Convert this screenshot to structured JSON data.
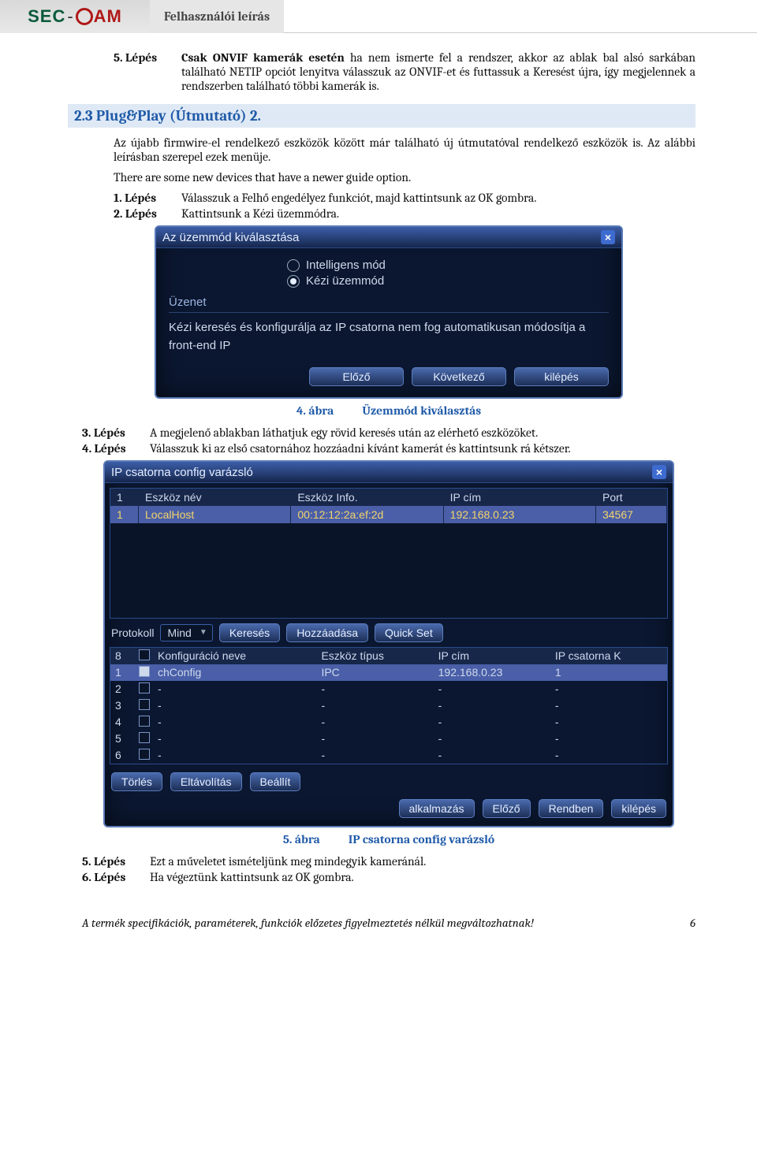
{
  "header": {
    "logo_sec": "SEC",
    "logo_cam": "AM",
    "tab": "Felhasználói leírás"
  },
  "step5": {
    "label": "5. Lépés",
    "text": "Csak ONVIF kamerák esetén ha nem ismerte fel a rendszer, akkor az ablak bal alsó sarkában található NETIP opciót lenyitva válasszuk az ONVIF-et és futtassuk a Keresést újra, így megjelennek a rendszerben található többi kamerák is.",
    "bold": "Csak ONVIF kamerák esetén"
  },
  "section": "2.3   Plug&Play (Útmutató) 2.",
  "para1": "Az újabb firmwire-el rendelkező eszközök között már található új útmutatóval rendelkező eszközök is. Az alábbi leírásban szerepel ezek menüje.",
  "para2": "There are some new devices that have a newer guide option.",
  "step1": {
    "label": "1. Lépés",
    "text": "Válasszuk a Felhő engedélyez funkciót, majd kattintsunk az OK gombra."
  },
  "step2": {
    "label": "2. Lépés",
    "text": "Kattintsunk a Kézi üzemmódra."
  },
  "shot1": {
    "title": "Az üzemmód kiválasztása",
    "opt1": "Intelligens mód",
    "opt2": "Kézi üzemmód",
    "group": "Üzenet",
    "msg": "Kézi keresés és konfigurálja az IP csatorna nem fog automatikusan módosítja a front-end IP",
    "btn_prev": "Előző",
    "btn_next": "Következő",
    "btn_exit": "kilépés"
  },
  "caption4": {
    "no": "4. ábra",
    "text": "Üzemmód kiválasztás"
  },
  "step3": {
    "label": "3. Lépés",
    "text": "A megjelenő ablakban láthatjuk egy rövid keresés után az elérhető eszközöket."
  },
  "step4": {
    "label": "4. Lépés",
    "text": "Válasszuk ki az első csatornához hozzáadni kívánt kamerát és kattintsunk rá kétszer."
  },
  "shot2": {
    "title": "IP csatorna config varázsló",
    "cols": {
      "c0": "1",
      "c1": "Eszköz név",
      "c2": "Eszköz Info.",
      "c3": "IP cím",
      "c4": "Port"
    },
    "row": {
      "c0": "1",
      "c1": "LocalHost",
      "c2": "00:12:12:2a:ef:2d",
      "c3": "192.168.0.23",
      "c4": "34567"
    },
    "proto_label": "Protokoll",
    "proto_value": "Mind",
    "btn_search": "Keresés",
    "btn_add": "Hozzáadása",
    "btn_quick": "Quick Set",
    "cols2": {
      "c0": "8",
      "c2": "Konfiguráció neve",
      "c3": "Eszköz típus",
      "c4": "IP cím",
      "c5": "IP csatorna K"
    },
    "rows2": [
      {
        "n": "1",
        "chk": true,
        "a": "chConfig",
        "b": "IPC",
        "c": "192.168.0.23",
        "d": "1"
      },
      {
        "n": "2",
        "chk": false,
        "a": "-",
        "b": "-",
        "c": "-",
        "d": "-"
      },
      {
        "n": "3",
        "chk": false,
        "a": "-",
        "b": "-",
        "c": "-",
        "d": "-"
      },
      {
        "n": "4",
        "chk": false,
        "a": "-",
        "b": "-",
        "c": "-",
        "d": "-"
      },
      {
        "n": "5",
        "chk": false,
        "a": "-",
        "b": "-",
        "c": "-",
        "d": "-"
      },
      {
        "n": "6",
        "chk": false,
        "a": "-",
        "b": "-",
        "c": "-",
        "d": "-"
      }
    ],
    "btn_del": "Törlés",
    "btn_rem": "Eltávolítás",
    "btn_set": "Beállít",
    "btn_apply": "alkalmazás",
    "btn_prev": "Előző",
    "btn_ok": "Rendben",
    "btn_exit": "kilépés"
  },
  "caption5": {
    "no": "5. ábra",
    "text": "IP csatorna config varázsló"
  },
  "step5b": {
    "label": "5. Lépés",
    "text": "Ezt a műveletet ismételjünk meg mindegyik kameránál."
  },
  "step6": {
    "label": "6. Lépés",
    "text": "Ha végeztünk kattintsunk az OK gombra."
  },
  "footer": {
    "text": "A termék specifikációk, paraméterek, funkciók előzetes figyelmeztetés nélkül megváltozhatnak!",
    "page": "6"
  }
}
